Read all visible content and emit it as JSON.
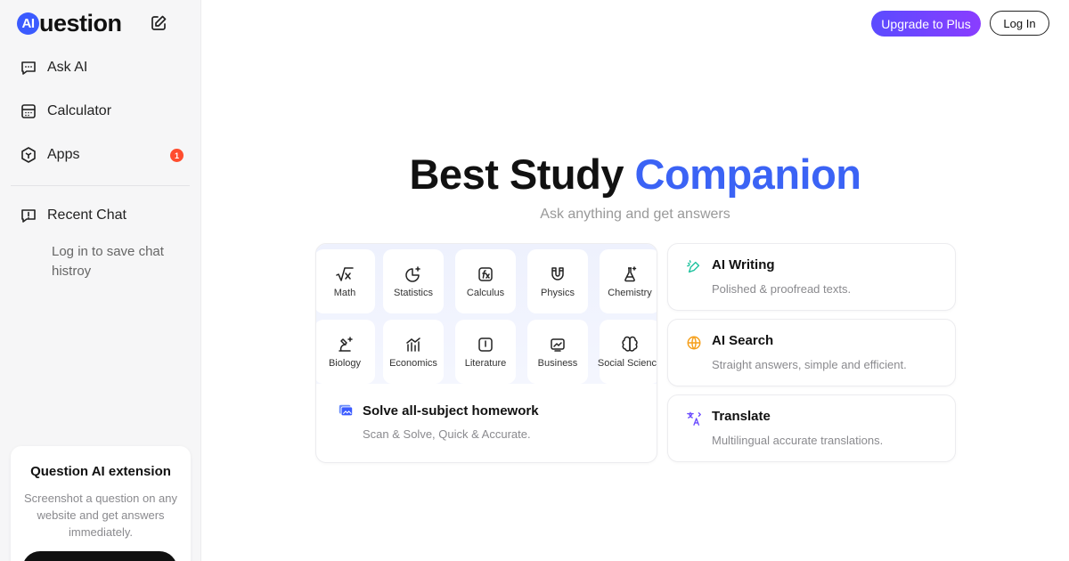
{
  "brand": {
    "logo_badge": "AI",
    "logo_text": "uestion"
  },
  "sidebar": {
    "items": [
      {
        "label": "Ask AI",
        "icon": "chat-bubble-icon"
      },
      {
        "label": "Calculator",
        "icon": "calculator-icon"
      },
      {
        "label": "Apps",
        "icon": "cube-icon",
        "badge": "1"
      }
    ],
    "recent_label": "Recent Chat",
    "recent_note": "Log in to save chat histroy"
  },
  "extension": {
    "title": "Question AI extension",
    "description": "Screenshot a question on any website and get answers immediately."
  },
  "header": {
    "upgrade_label": "Upgrade to Plus",
    "login_label": "Log In"
  },
  "hero": {
    "title_main": "Best Study ",
    "title_accent": "Companion",
    "subtitle": "Ask anything and get answers"
  },
  "homework": {
    "subjects": [
      "Math",
      "Statistics",
      "Calculus",
      "Physics",
      "Chemistry",
      "Biology",
      "Economics",
      "Literature",
      "Business",
      "Social Science"
    ],
    "title": "Solve all-subject homework",
    "description": "Scan & Solve, Quick & Accurate."
  },
  "features": [
    {
      "title": "AI Writing",
      "description": "Polished & proofread texts.",
      "icon": "writing-icon"
    },
    {
      "title": "AI Search",
      "description": "Straight answers, simple and efficient.",
      "icon": "globe-icon"
    },
    {
      "title": "Translate",
      "description": "Multilingual accurate translations.",
      "icon": "translate-icon"
    }
  ],
  "colors": {
    "brand_blue": "#3b63f5",
    "upgrade_start": "#5b4bff",
    "upgrade_end": "#8a3dff",
    "badge_red": "#ff4d2e"
  }
}
